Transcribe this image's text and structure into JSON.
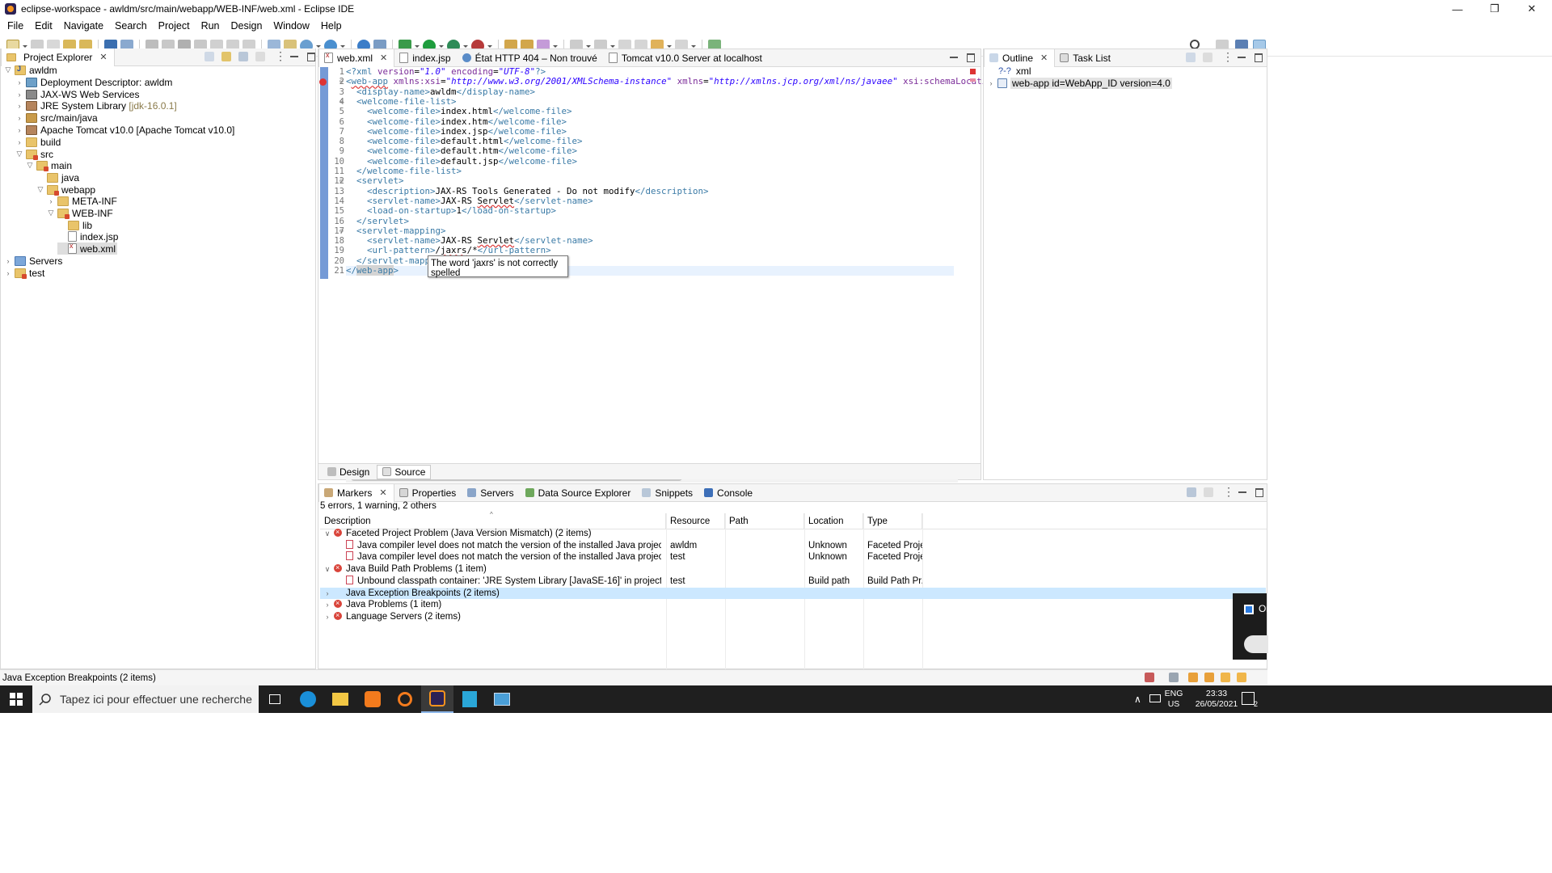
{
  "window": {
    "title": "eclipse-workspace - awldm/src/main/webapp/WEB-INF/web.xml - Eclipse IDE"
  },
  "menu": [
    "File",
    "Edit",
    "Navigate",
    "Search",
    "Project",
    "Run",
    "Design",
    "Window",
    "Help"
  ],
  "explorer": {
    "tab_label": "Project Explorer",
    "tree": [
      {
        "label": "awldm",
        "extra": "",
        "icon": "project-icon"
      },
      {
        "label": "Deployment Descriptor: awldm",
        "extra": "",
        "icon": "deployment-descriptor-icon"
      },
      {
        "label": "JAX-WS Web Services",
        "extra": "",
        "icon": "web-services-icon"
      },
      {
        "label": "JRE System Library",
        "extra": "[jdk-16.0.1]",
        "icon": "library-icon"
      },
      {
        "label": "src/main/java",
        "extra": "",
        "icon": "source-folder-icon"
      },
      {
        "label": "Apache Tomcat v10.0 [Apache Tomcat v10.0]",
        "extra": "",
        "icon": "library-icon"
      },
      {
        "label": "build",
        "extra": "",
        "icon": "folder-icon"
      },
      {
        "label": "src",
        "extra": "",
        "icon": "folder-icon"
      },
      {
        "label": "main",
        "extra": "",
        "icon": "folder-icon"
      },
      {
        "label": "java",
        "extra": "",
        "icon": "folder-icon"
      },
      {
        "label": "webapp",
        "extra": "",
        "icon": "folder-icon"
      },
      {
        "label": "META-INF",
        "extra": "",
        "icon": "folder-icon"
      },
      {
        "label": "WEB-INF",
        "extra": "",
        "icon": "folder-icon"
      },
      {
        "label": "lib",
        "extra": "",
        "icon": "folder-icon"
      },
      {
        "label": "index.jsp",
        "extra": "",
        "icon": "jsp-file-icon"
      },
      {
        "label": "web.xml",
        "extra": "",
        "icon": "xml-file-icon"
      },
      {
        "label": "Servers",
        "extra": "",
        "icon": "servers-folder-icon"
      },
      {
        "label": "test",
        "extra": "",
        "icon": "project-icon"
      }
    ]
  },
  "editor": {
    "tabs": [
      {
        "label": "web.xml",
        "active": true
      },
      {
        "label": "index.jsp",
        "active": false
      },
      {
        "label": "État HTTP 404 – Non trouvé",
        "active": false
      },
      {
        "label": "Tomcat v10.0 Server at localhost",
        "active": false
      }
    ],
    "line_numbers": [
      "1",
      "2",
      "3",
      "4",
      "5",
      "6",
      "7",
      "8",
      "9",
      "10",
      "11",
      "12",
      "13",
      "14",
      "15",
      "16",
      "17",
      "18",
      "19",
      "20",
      "21"
    ],
    "tooltip": "The word 'jaxrs' is not correctly spelled",
    "bottom_tabs": [
      "Design",
      "Source"
    ]
  },
  "outline": {
    "tabs": [
      "Outline",
      "Task List"
    ],
    "items": [
      "xml",
      "web-app id=WebApp_ID version=4.0"
    ]
  },
  "markers": {
    "tabs": [
      "Markers",
      "Properties",
      "Servers",
      "Data Source Explorer",
      "Snippets",
      "Console"
    ],
    "summary": "5 errors, 1 warning, 2 others",
    "columns": [
      "Description",
      "Resource",
      "Path",
      "Location",
      "Type"
    ],
    "rows": [
      {
        "description": "Faceted Project Problem (Java Version Mismatch) (2 items)",
        "resource": "",
        "path": "",
        "location": "",
        "type": ""
      },
      {
        "description": "Java compiler level does not match the version of the installed Java project facet.",
        "resource": "awldm",
        "path": "",
        "location": "Unknown",
        "type": "Faceted Proje..."
      },
      {
        "description": "Java compiler level does not match the version of the installed Java project facet.",
        "resource": "test",
        "path": "",
        "location": "Unknown",
        "type": "Faceted Proje..."
      },
      {
        "description": "Java Build Path Problems (1 item)",
        "resource": "",
        "path": "",
        "location": "",
        "type": ""
      },
      {
        "description": "Unbound classpath container: 'JRE System Library [JavaSE-16]' in project 'test'",
        "resource": "test",
        "path": "",
        "location": "Build path",
        "type": "Build Path Pr..."
      },
      {
        "description": "Java Exception Breakpoints (2 items)",
        "resource": "",
        "path": "",
        "location": "",
        "type": ""
      },
      {
        "description": "Java Problems (1 item)",
        "resource": "",
        "path": "",
        "location": "",
        "type": ""
      },
      {
        "description": "Language Servers (2 items)",
        "resource": "",
        "path": "",
        "location": "",
        "type": ""
      }
    ]
  },
  "status": {
    "text": "Java Exception Breakpoints (2 items)"
  },
  "taskbar": {
    "search_placeholder": "Tapez ici pour effectuer une recherche",
    "lang_line1": "ENG",
    "lang_line2": "US",
    "time": "23:33",
    "date": "26/05/2021",
    "notif_count": "2",
    "toast_text": "On"
  }
}
